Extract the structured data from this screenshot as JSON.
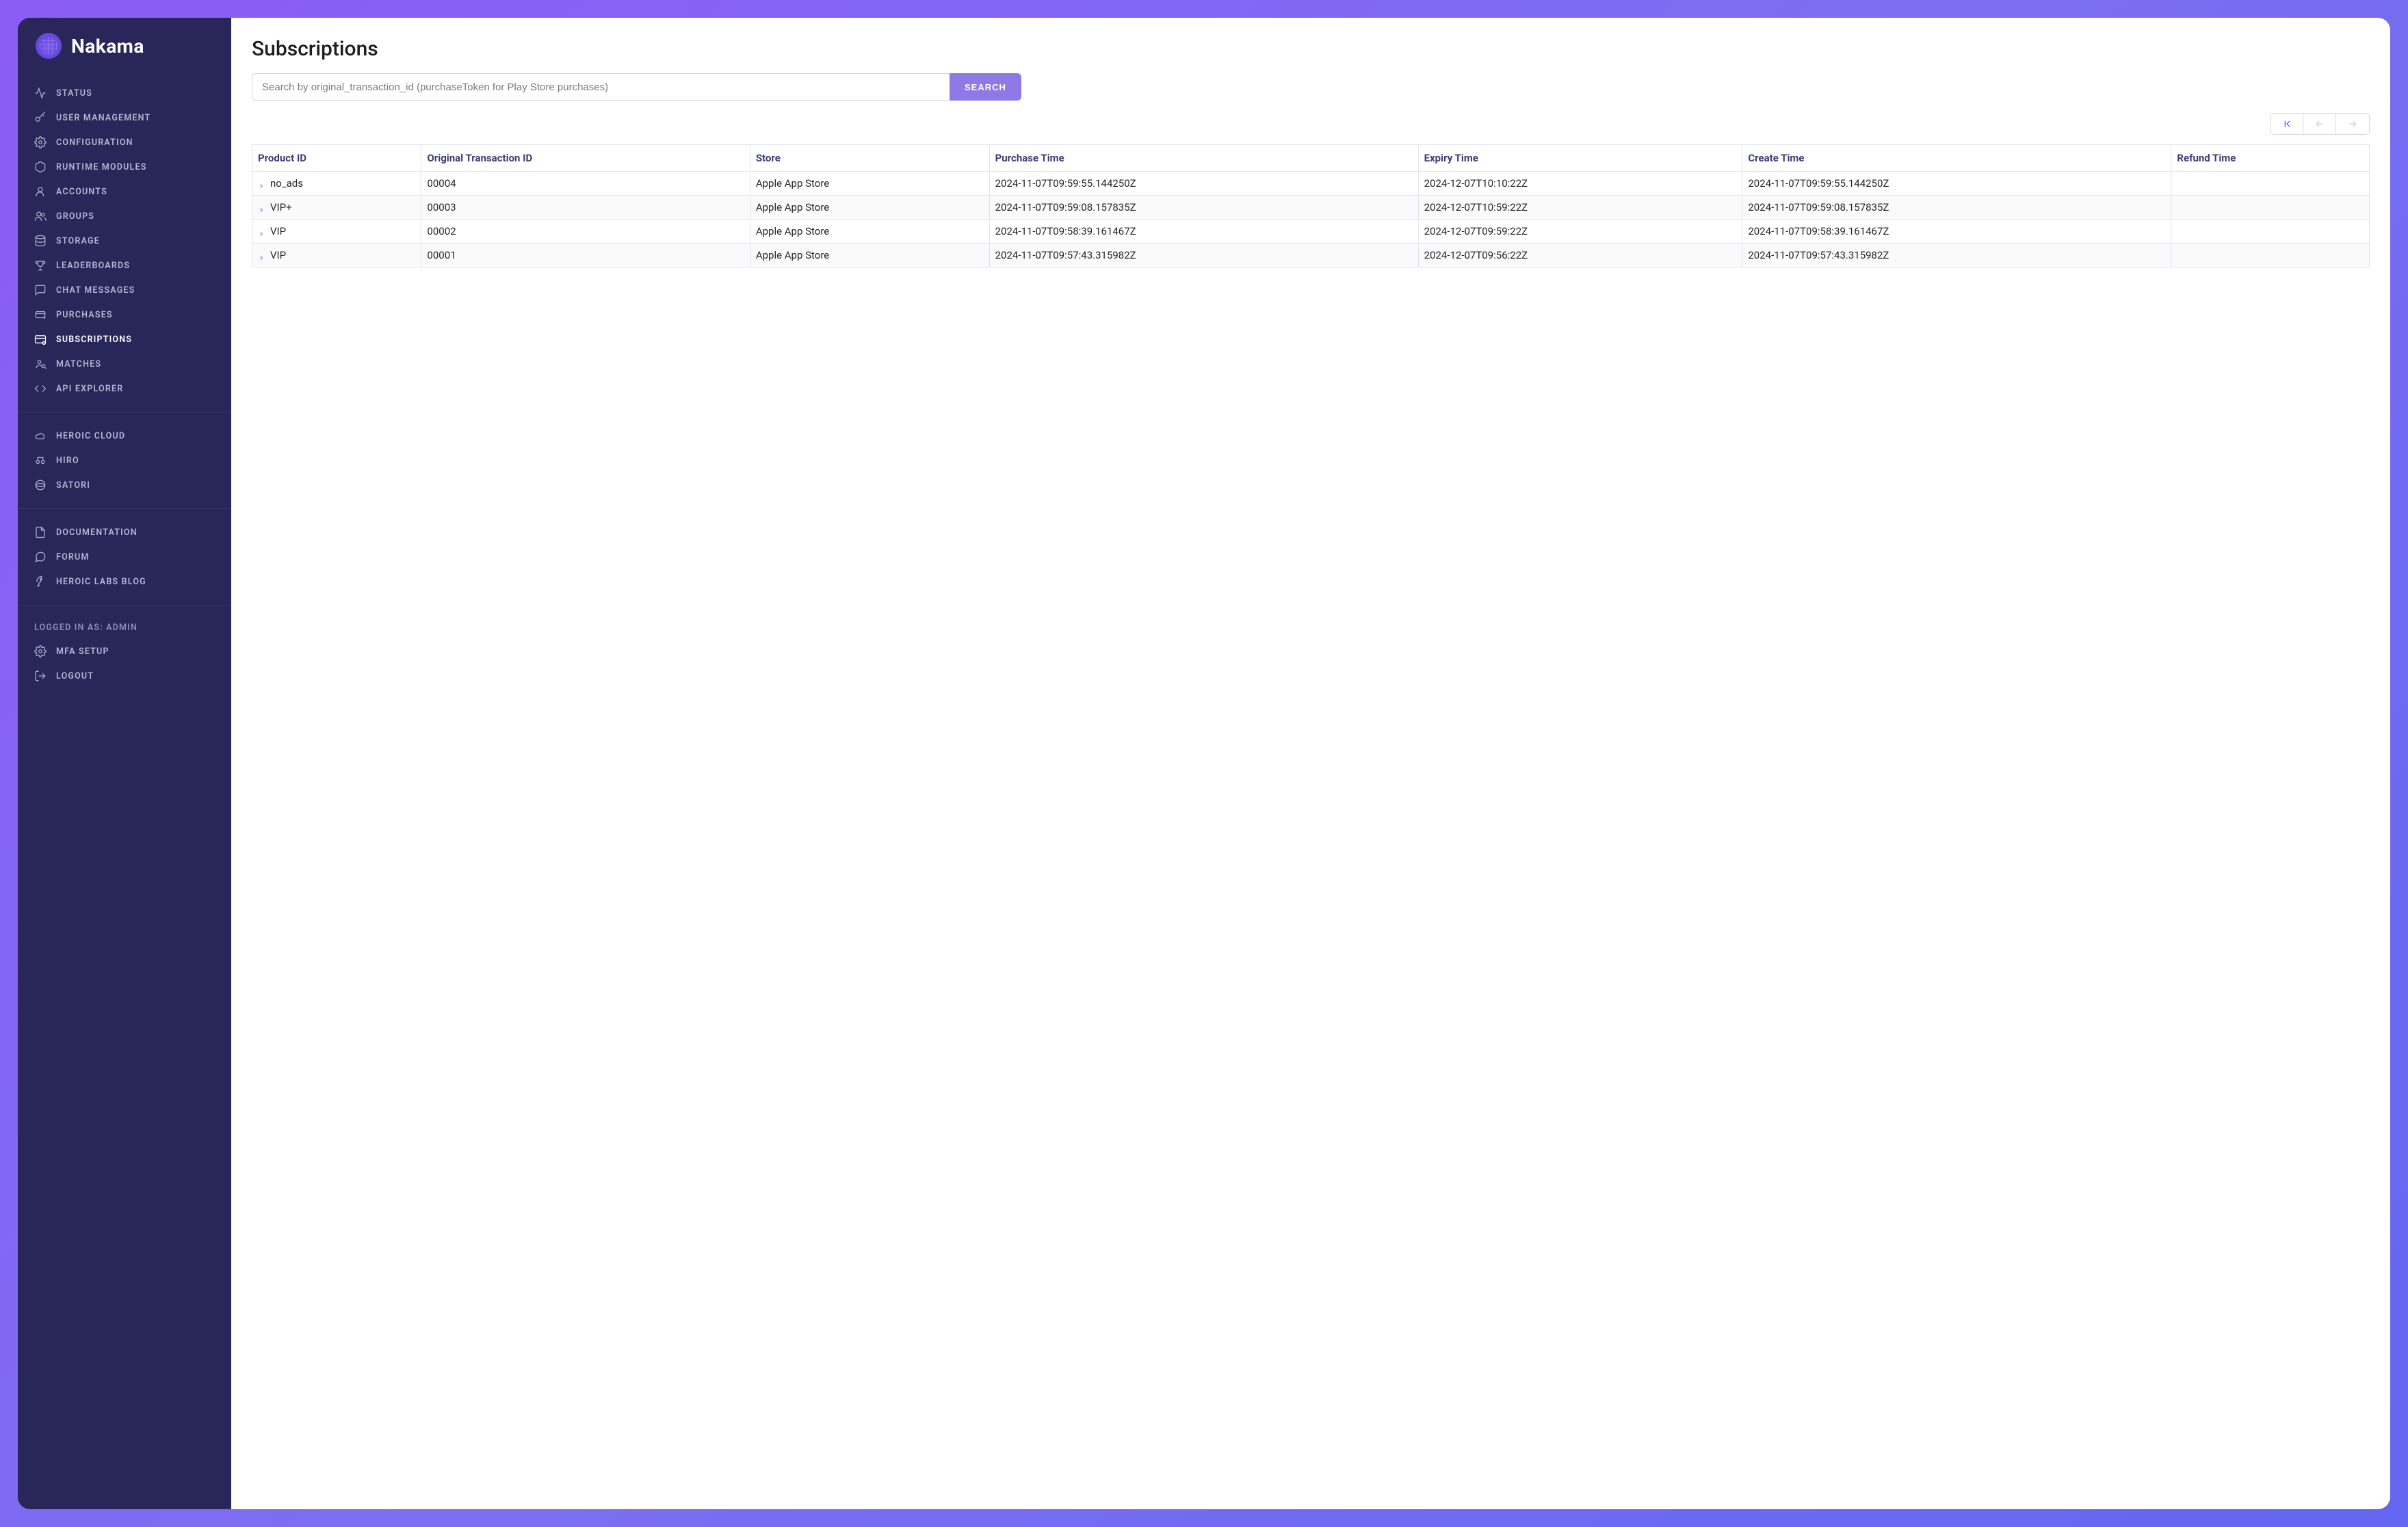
{
  "brand": {
    "name": "Nakama"
  },
  "sidebar": {
    "primary": [
      {
        "label": "Status",
        "icon": "activity-icon"
      },
      {
        "label": "User Management",
        "icon": "key-icon"
      },
      {
        "label": "Configuration",
        "icon": "gear-icon"
      },
      {
        "label": "Runtime Modules",
        "icon": "hexagon-icon"
      },
      {
        "label": "Accounts",
        "icon": "user-icon"
      },
      {
        "label": "Groups",
        "icon": "users-icon"
      },
      {
        "label": "Storage",
        "icon": "database-icon"
      },
      {
        "label": "Leaderboards",
        "icon": "trophy-icon"
      },
      {
        "label": "Chat Messages",
        "icon": "message-icon"
      },
      {
        "label": "Purchases",
        "icon": "cart-icon"
      },
      {
        "label": "Subscriptions",
        "icon": "card-icon",
        "active": true
      },
      {
        "label": "Matches",
        "icon": "search-user-icon"
      },
      {
        "label": "API Explorer",
        "icon": "code-icon"
      }
    ],
    "external": [
      {
        "label": "Heroic Cloud",
        "icon": "cloud-icon"
      },
      {
        "label": "Hiro",
        "icon": "hiro-icon"
      },
      {
        "label": "Satori",
        "icon": "satori-icon"
      }
    ],
    "resources": [
      {
        "label": "Documentation",
        "icon": "document-icon"
      },
      {
        "label": "Forum",
        "icon": "chat-icon"
      },
      {
        "label": "Heroic Labs Blog",
        "icon": "rocket-icon"
      }
    ],
    "session_label": "Logged in as: admin",
    "session_items": [
      {
        "label": "MFA Setup",
        "icon": "gear-icon"
      },
      {
        "label": "Logout",
        "icon": "logout-icon"
      }
    ]
  },
  "page": {
    "title": "Subscriptions",
    "search_placeholder": "Search by original_transaction_id (purchaseToken for Play Store purchases)",
    "search_button": "SEARCH"
  },
  "table": {
    "headers": [
      "Product ID",
      "Original Transaction ID",
      "Store",
      "Purchase Time",
      "Expiry Time",
      "Create Time",
      "Refund Time"
    ],
    "rows": [
      {
        "product_id": "no_ads",
        "original_transaction_id": "00004",
        "store": "Apple App Store",
        "purchase_time": "2024-11-07T09:59:55.144250Z",
        "expiry_time": "2024-12-07T10:10:22Z",
        "create_time": "2024-11-07T09:59:55.144250Z",
        "refund_time": ""
      },
      {
        "product_id": "VIP+",
        "original_transaction_id": "00003",
        "store": "Apple App Store",
        "purchase_time": "2024-11-07T09:59:08.157835Z",
        "expiry_time": "2024-12-07T10:59:22Z",
        "create_time": "2024-11-07T09:59:08.157835Z",
        "refund_time": ""
      },
      {
        "product_id": "VIP",
        "original_transaction_id": "00002",
        "store": "Apple App Store",
        "purchase_time": "2024-11-07T09:58:39.161467Z",
        "expiry_time": "2024-12-07T09:59:22Z",
        "create_time": "2024-11-07T09:58:39.161467Z",
        "refund_time": ""
      },
      {
        "product_id": "VIP",
        "original_transaction_id": "00001",
        "store": "Apple App Store",
        "purchase_time": "2024-11-07T09:57:43.315982Z",
        "expiry_time": "2024-12-07T09:56:22Z",
        "create_time": "2024-11-07T09:57:43.315982Z",
        "refund_time": ""
      }
    ]
  }
}
